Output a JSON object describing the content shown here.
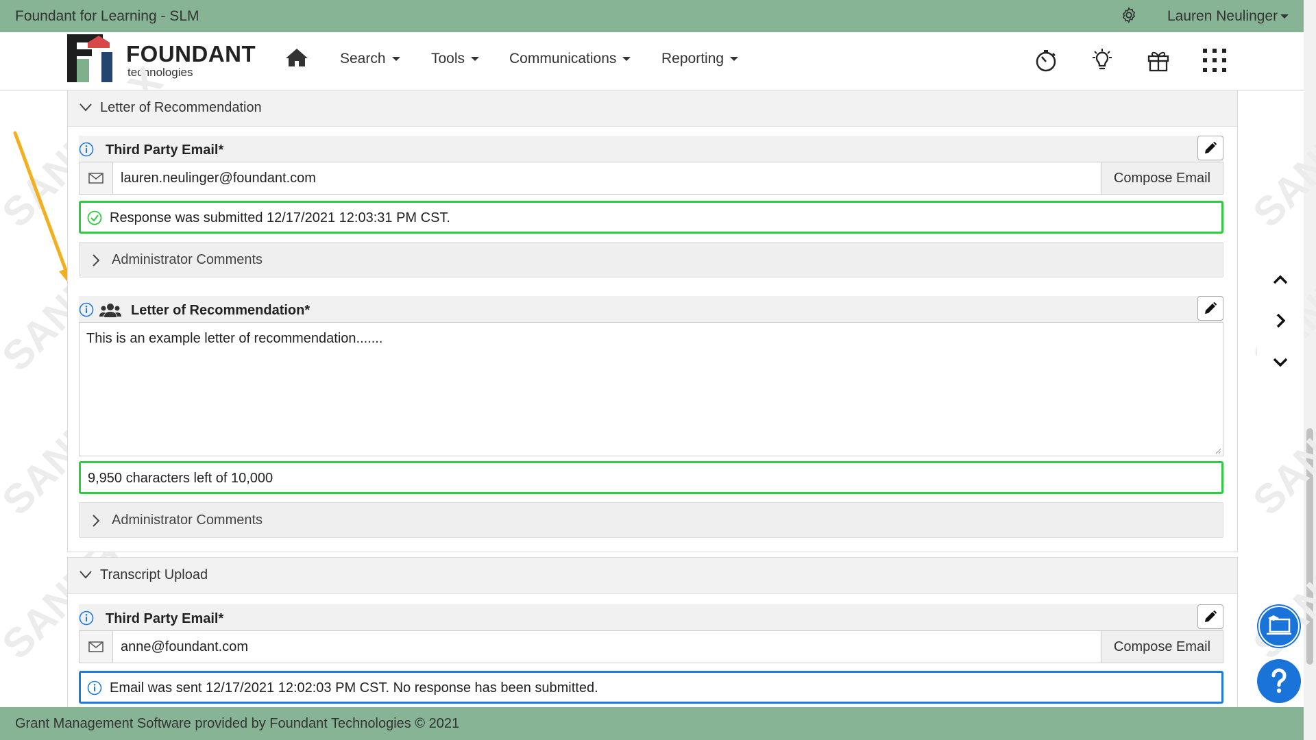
{
  "topbar": {
    "app_title": "Foundant for Learning - SLM",
    "user_name": "Lauren Neulinger"
  },
  "logo": {
    "word": "FOUNDANT",
    "sub": "technologies"
  },
  "nav": {
    "items": [
      {
        "label": "Search"
      },
      {
        "label": "Tools"
      },
      {
        "label": "Communications"
      },
      {
        "label": "Reporting"
      }
    ],
    "icons": [
      "home-icon",
      "stopwatch-icon",
      "lightbulb-icon",
      "gift-icon",
      "app-grid-icon"
    ]
  },
  "watermark": "SANDBOX",
  "sections": [
    {
      "title": "Letter of Recommendation",
      "email_field": {
        "label": "Third Party Email*",
        "value": "lauren.neulinger@foundant.com",
        "compose_label": "Compose Email",
        "status": "Response was submitted 12/17/2021 12:03:31 PM CST.",
        "comments_label": "Administrator Comments"
      },
      "letter_field": {
        "label": "Letter of Recommendation*",
        "value": "This is an example letter of recommendation.......",
        "char_count": "9,950 characters left of 10,000",
        "comments_label": "Administrator Comments"
      }
    },
    {
      "title": "Transcript Upload",
      "email_field": {
        "label": "Third Party Email*",
        "value": "anne@foundant.com",
        "compose_label": "Compose Email",
        "status": "Email was sent 12/17/2021 12:02:03 PM CST. No response has been submitted."
      }
    }
  ],
  "footer": {
    "text": "Grant Management Software provided by Foundant Technologies © 2021"
  },
  "colors": {
    "topbar": "#88b496",
    "success_border": "#2ecc40",
    "info_border": "#1e7be0",
    "help_button": "#1a73d9",
    "annotation_arrow": "#f2b01e"
  }
}
